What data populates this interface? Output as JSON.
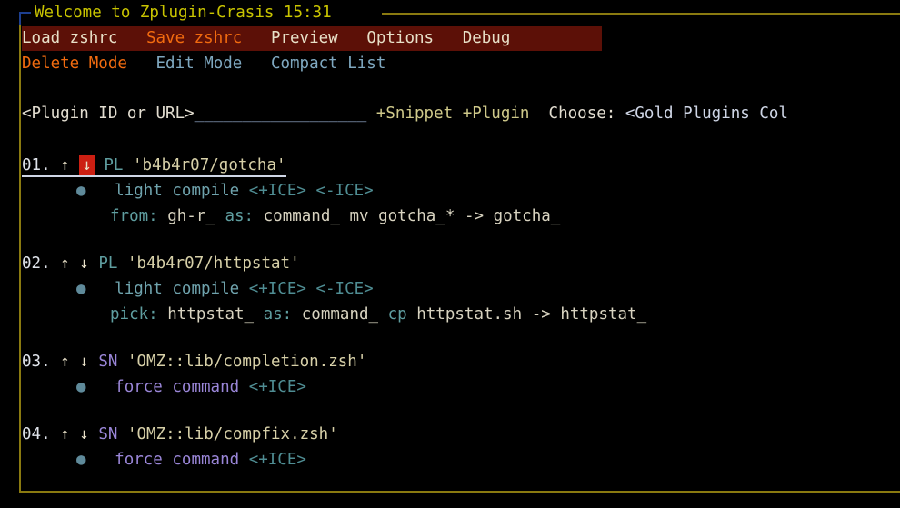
{
  "window": {
    "title": "Welcome to Zplugin-Crasis 15:31",
    "title_color": "#c9c400",
    "border_color": "#8a7a10",
    "border_accent_color": "#1d3f8f",
    "background": "#000000"
  },
  "menu": {
    "background": "#5c1007",
    "row1": [
      {
        "label": "Load zshrc",
        "color": "#e8e0c8",
        "style": "cream"
      },
      {
        "label": "Save zshrc",
        "color": "#f26b0f",
        "style": "orange"
      },
      {
        "label": "Preview",
        "color": "#e8e0c8",
        "style": "cream"
      },
      {
        "label": "Options",
        "color": "#e8e0c8",
        "style": "cream"
      },
      {
        "label": "Debug",
        "color": "#e8e0c8",
        "style": "cream"
      }
    ],
    "row2": [
      {
        "label": "Delete Mode",
        "color": "#f26b0f",
        "style": "orange"
      },
      {
        "label": "Edit Mode",
        "color": "#7fa8c0",
        "style": "blue"
      },
      {
        "label": "Compact List",
        "color": "#7fa8c0",
        "style": "blue"
      }
    ]
  },
  "prompt": {
    "field_label": "<Plugin ID or URL>",
    "field_value": "",
    "field_underscores": "__________________",
    "add_snippet_label": "+Snippet",
    "add_plugin_label": "+Plugin",
    "choose_label": "Choose:",
    "choose_value": "<Gold Plugins Col"
  },
  "entries": [
    {
      "num": "01.",
      "up": "↑",
      "down": "↓",
      "down_highlighted": true,
      "type": "PL",
      "type_kind": "plugin",
      "id": "'b4b4r07/gotcha'",
      "selected": true,
      "ice_bullet": "●",
      "ice": [
        {
          "text": "light",
          "kind": "key"
        },
        {
          "text": "compile",
          "kind": "key"
        },
        {
          "text": "<+ICE>",
          "kind": "tag"
        },
        {
          "text": "<-ICE>",
          "kind": "tag"
        }
      ],
      "detail": [
        {
          "text": "from:",
          "kind": "key"
        },
        {
          "text": "gh-r_",
          "kind": "val"
        },
        {
          "text": "as:",
          "kind": "key"
        },
        {
          "text": "command_",
          "kind": "val"
        },
        {
          "text": "mv",
          "kind": "val"
        },
        {
          "text": "gotcha_*",
          "kind": "val"
        },
        {
          "text": "->",
          "kind": "val"
        },
        {
          "text": "gotcha_",
          "kind": "val"
        }
      ]
    },
    {
      "num": "02.",
      "up": "↑",
      "down": "↓",
      "down_highlighted": false,
      "type": "PL",
      "type_kind": "plugin",
      "id": "'b4b4r07/httpstat'",
      "selected": false,
      "ice_bullet": "●",
      "ice": [
        {
          "text": "light",
          "kind": "key"
        },
        {
          "text": "compile",
          "kind": "key"
        },
        {
          "text": "<+ICE>",
          "kind": "tag"
        },
        {
          "text": "<-ICE>",
          "kind": "tag"
        }
      ],
      "detail": [
        {
          "text": "pick:",
          "kind": "key"
        },
        {
          "text": "httpstat_",
          "kind": "val"
        },
        {
          "text": "as:",
          "kind": "key"
        },
        {
          "text": "command_",
          "kind": "val"
        },
        {
          "text": "cp",
          "kind": "key"
        },
        {
          "text": "httpstat.sh",
          "kind": "val"
        },
        {
          "text": "->",
          "kind": "val"
        },
        {
          "text": "httpstat_",
          "kind": "val"
        }
      ]
    },
    {
      "num": "03.",
      "up": "↑",
      "down": "↓",
      "down_highlighted": false,
      "type": "SN",
      "type_kind": "snippet",
      "id": "'OMZ::lib/completion.zsh'",
      "selected": false,
      "ice_bullet": "●",
      "ice": [
        {
          "text": "force",
          "kind": "purple"
        },
        {
          "text": "command",
          "kind": "purple"
        },
        {
          "text": "<+ICE>",
          "kind": "tag"
        }
      ],
      "detail": []
    },
    {
      "num": "04.",
      "up": "↑",
      "down": "↓",
      "down_highlighted": false,
      "type": "SN",
      "type_kind": "snippet",
      "id": "'OMZ::lib/compfix.zsh'",
      "selected": false,
      "ice_bullet": "●",
      "ice": [
        {
          "text": "force",
          "kind": "purple"
        },
        {
          "text": "command",
          "kind": "purple"
        },
        {
          "text": "<+ICE>",
          "kind": "tag"
        }
      ],
      "detail": []
    }
  ]
}
